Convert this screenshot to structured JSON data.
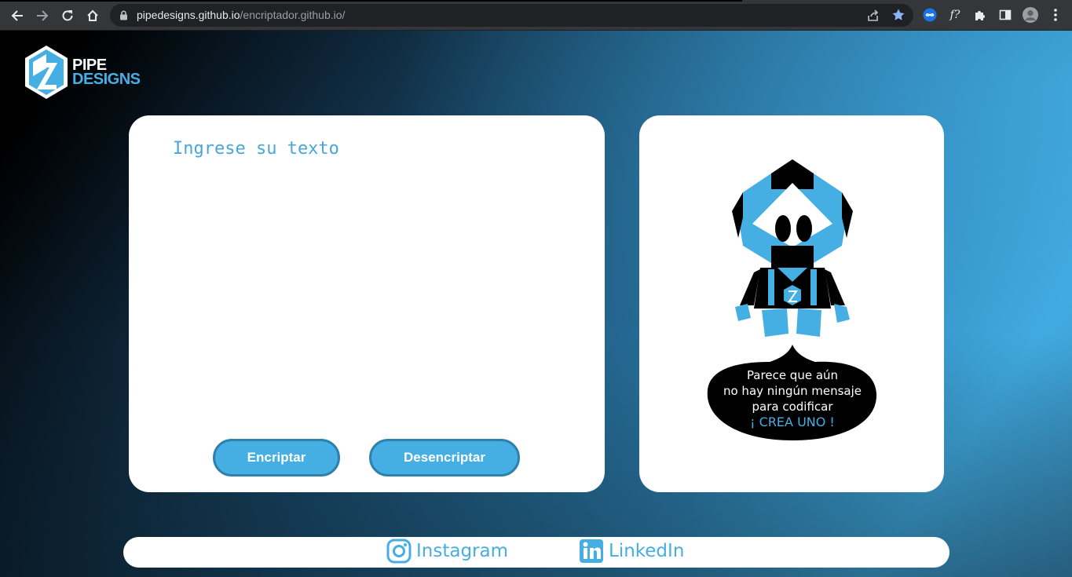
{
  "browser": {
    "url_host": "pipedesigns.github.io",
    "url_path": "/encriptador.github.io/",
    "nav_buttons": [
      "back-icon",
      "forward-icon",
      "reload-icon",
      "home-icon"
    ],
    "extensions": [
      "extension-infinity-icon",
      "extension-fx-icon",
      "puzzle-icon",
      "sidepanel-icon",
      "profile-avatar",
      "menu-kebab-icon"
    ]
  },
  "logo": {
    "line1": "PIPE",
    "line2": "DESIGNS"
  },
  "input": {
    "placeholder": "Ingrese su texto",
    "value": ""
  },
  "buttons": {
    "encrypt": "Encriptar",
    "decrypt": "Desencriptar"
  },
  "output": {
    "message_line1": "Parece que aún",
    "message_line2": "no hay ningún mensaje",
    "message_line3": "para codificar",
    "cta": "¡ CREA UNO !"
  },
  "footer": {
    "instagram": "Instagram",
    "linkedin": "LinkedIn"
  },
  "colors": {
    "accent": "#45aee3",
    "accent_dark": "#2f81ad",
    "card": "#ffffff",
    "robot_black": "#000000"
  }
}
